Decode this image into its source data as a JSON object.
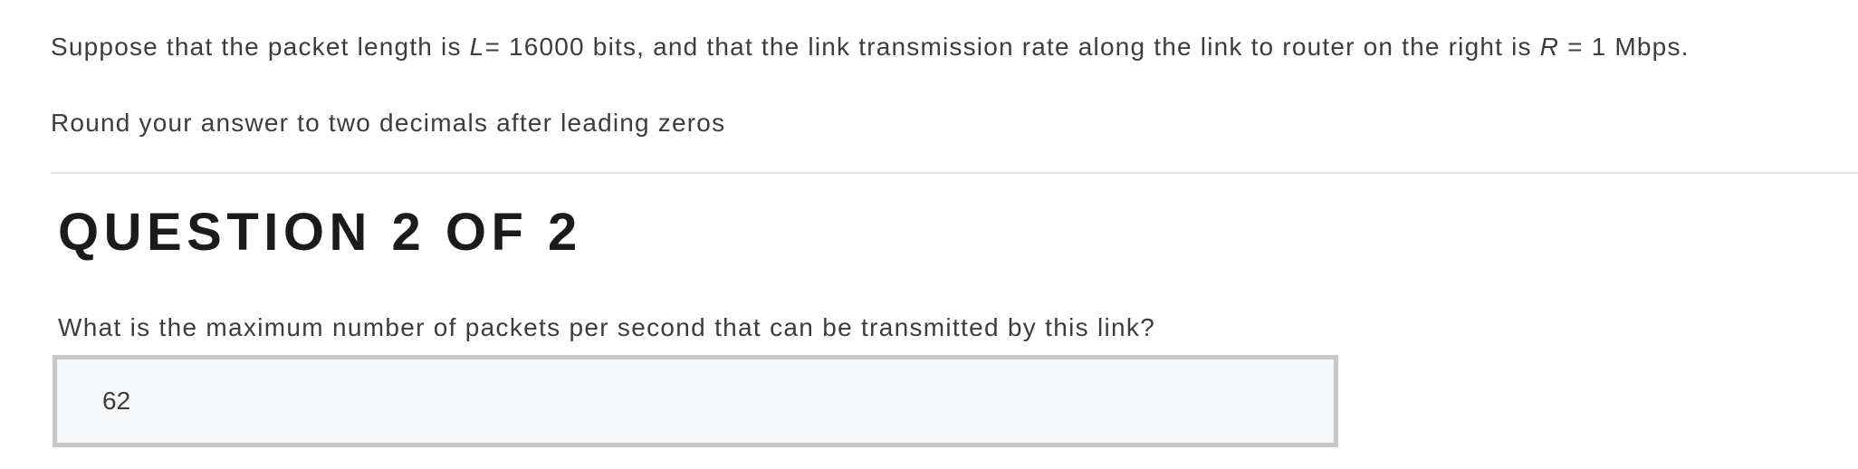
{
  "problem": {
    "line1_before_L": "Suppose that the packet length is ",
    "var_L": "L",
    "line1_mid": "= 16000 bits, and that the link transmission rate along the link to router on the right is ",
    "var_R": "R",
    "line1_end": " = 1 Mbps.",
    "line2": "Round your answer to two decimals after leading zeros"
  },
  "question": {
    "heading": "QUESTION 2 OF 2",
    "prompt": "What is the maximum number of packets per second that can be transmitted by this link?",
    "answer_value": "62"
  }
}
